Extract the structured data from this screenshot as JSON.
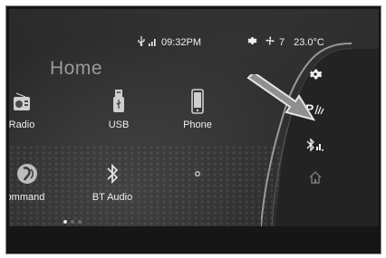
{
  "status_bar": {
    "time": "09:32PM",
    "fan_level": "7",
    "temperature": "23.0°C"
  },
  "home": {
    "title": "Home",
    "tiles": [
      {
        "label": "Radio",
        "icon": "radio-icon"
      },
      {
        "label": "USB",
        "icon": "usb-icon"
      },
      {
        "label": "Phone",
        "icon": "phone-icon"
      },
      {
        "label": "Command",
        "icon": "voice-command-icon"
      },
      {
        "label": "BT Audio",
        "icon": "bluetooth-icon"
      },
      {
        "label": "",
        "icon": "empty-slot-icon"
      }
    ],
    "pager": {
      "pages": 3,
      "active": 1
    }
  },
  "side_bar": {
    "items": [
      {
        "icon": "gear-icon"
      },
      {
        "icon": "parking-sensor-icon"
      },
      {
        "icon": "bluetooth-signal-icon"
      },
      {
        "icon": "home-icon"
      }
    ]
  },
  "colors": {
    "screen_bg": "#2c2c2c",
    "text": "#f0f0f0",
    "title": "#9a9a9a",
    "callout_arrow": "#8c8c8c"
  }
}
